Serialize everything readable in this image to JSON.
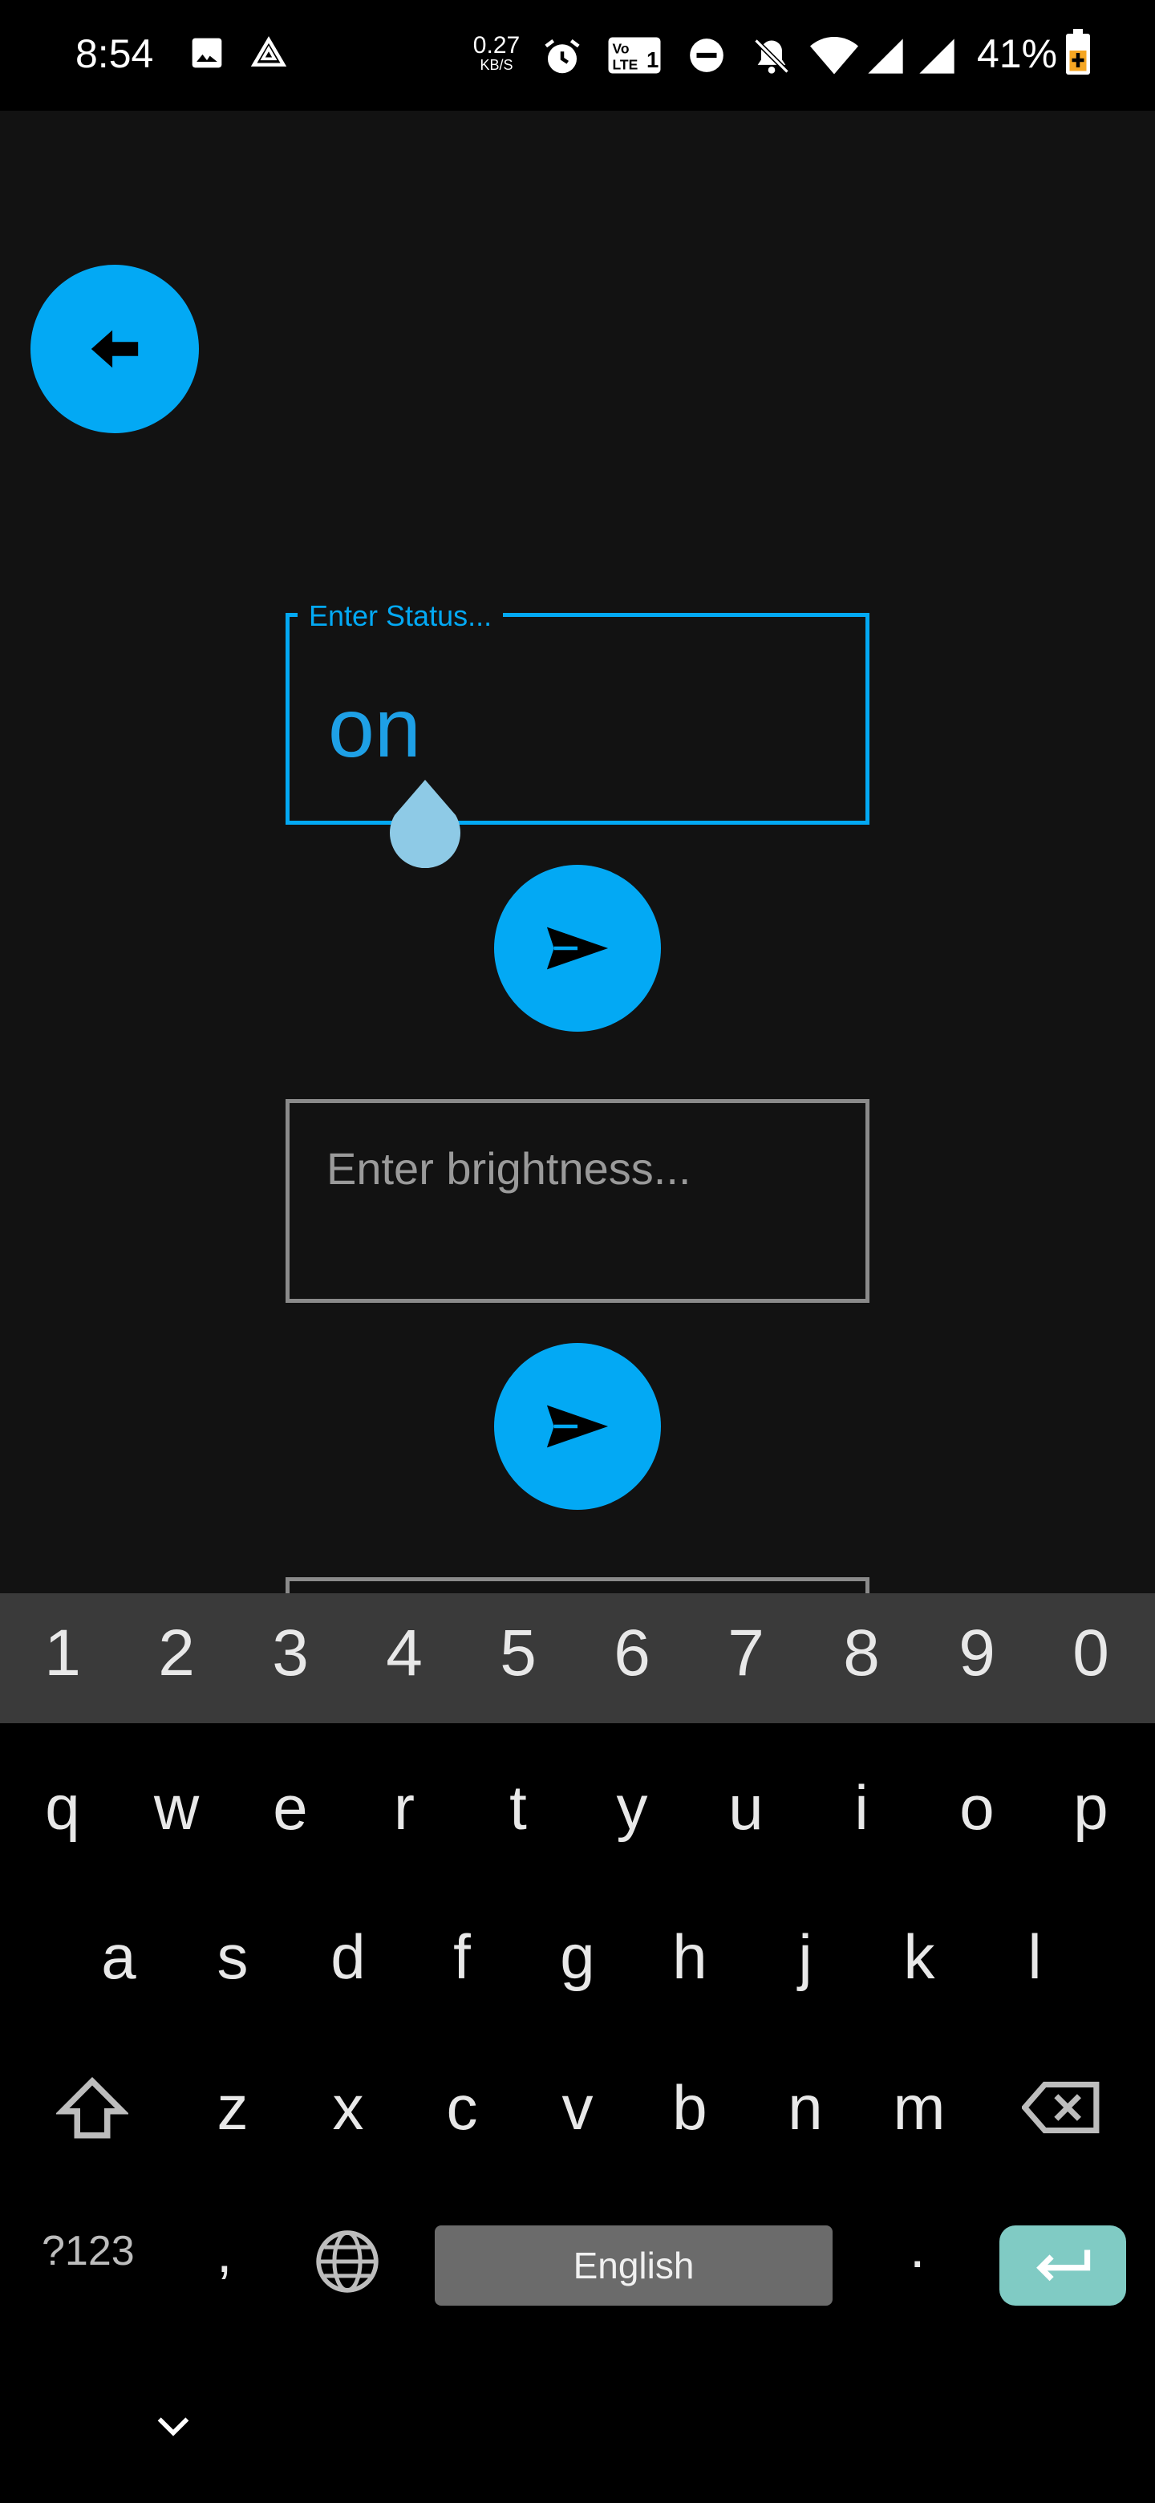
{
  "status_bar": {
    "time": "8:54",
    "net_speed_value": "0.27",
    "net_speed_unit": "KB/S",
    "battery": "41%"
  },
  "form": {
    "status_label": "Enter Status...",
    "status_value": "on",
    "brightness_placeholder": "Enter brightness..."
  },
  "keyboard": {
    "numbers": [
      "1",
      "2",
      "3",
      "4",
      "5",
      "6",
      "7",
      "8",
      "9",
      "0"
    ],
    "row1": [
      "q",
      "w",
      "e",
      "r",
      "t",
      "y",
      "u",
      "i",
      "o",
      "p"
    ],
    "row2": [
      "a",
      "s",
      "d",
      "f",
      "g",
      "h",
      "j",
      "k",
      "l"
    ],
    "row3": [
      "z",
      "x",
      "c",
      "v",
      "b",
      "n",
      "m"
    ],
    "symbols_label": "?123",
    "comma": ",",
    "space_label": "English",
    "period": "."
  },
  "colors": {
    "accent": "#03a9f4",
    "background": "#121212",
    "enter_key": "#80cbc4"
  }
}
